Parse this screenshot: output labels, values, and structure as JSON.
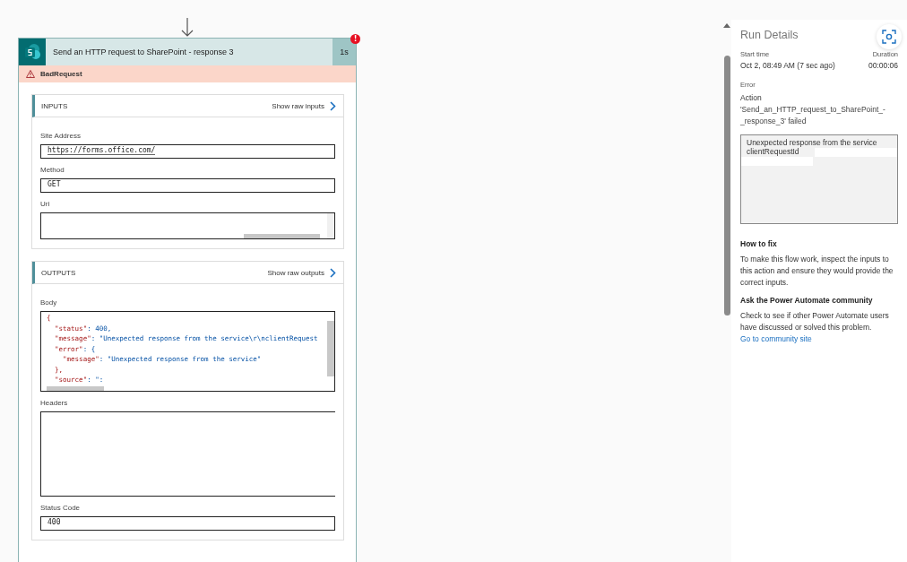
{
  "action_card": {
    "title": "Send an HTTP request to SharePoint - response 3",
    "duration": "1s",
    "error_badge": "!",
    "status": "BadRequest",
    "inputs": {
      "heading": "INPUTS",
      "raw_link": "Show raw inputs",
      "fields": [
        {
          "label": "Site Address",
          "value": "https://forms.office.com/",
          "kind": "link"
        },
        {
          "label": "Method",
          "value": "GET",
          "kind": "text"
        },
        {
          "label": "Uri",
          "kind": "scroll"
        }
      ]
    },
    "outputs": {
      "heading": "OUTPUTS",
      "raw_link": "Show raw outputs",
      "body": {
        "label": "Body",
        "lines": [
          "{",
          "  \"status\": 400,",
          "  \"message\": \"Unexpected response from the service\\r\\nclientRequest",
          "  \"error\": {",
          "    \"message\": \"Unexpected response from the service\"",
          "  },",
          "  \"source\": \":"
        ]
      },
      "headers": {
        "label": "Headers"
      },
      "status_code": {
        "label": "Status Code",
        "value": "400"
      }
    }
  },
  "run_details": {
    "title": "Run Details",
    "start_label": "Start time",
    "start_value": "Oct 2, 08:49 AM (7 sec ago)",
    "duration_label": "Duration",
    "duration_value": "00:00:06",
    "error_label": "Error",
    "error_title": "Action",
    "error_text": "'Send_an_HTTP_request_to_SharePoint_-_response_3' failed",
    "error_box_lines": [
      "Unexpected response from the service",
      "clientRequestId"
    ],
    "fix_heading": "How to fix",
    "fix_text": "To make this flow work, inspect the inputs to this action and ensure they would provide the correct inputs.",
    "community_heading": "Ask the Power Automate community",
    "community_text": "Check to see if other Power Automate users have discussed or solved this problem.",
    "community_link": "Go to community site"
  }
}
